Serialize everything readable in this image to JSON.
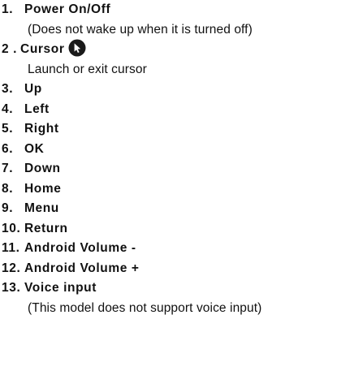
{
  "items": [
    {
      "num": "1.",
      "label": "Power On/Off",
      "note": "(Does not wake up when it is turned off)"
    },
    {
      "num": "2 .",
      "label": "Cursor",
      "icon": "cursor-arrow-icon",
      "note": "Launch or exit cursor"
    },
    {
      "num": "3.",
      "label": "Up"
    },
    {
      "num": "4.",
      "label": "Left"
    },
    {
      "num": "5.",
      "label": "Right"
    },
    {
      "num": "6.",
      "label": "OK"
    },
    {
      "num": "7.",
      "label": "Down"
    },
    {
      "num": "8.",
      "label": "Home"
    },
    {
      "num": "9.",
      "label": "Menu"
    },
    {
      "num": "10.",
      "label": "Return"
    },
    {
      "num": "11.",
      "label": "Android Volume -"
    },
    {
      "num": "12.",
      "label": "Android Volume +"
    },
    {
      "num": "13.",
      "label": "Voice input",
      "note": "(This model does not support voice input)"
    }
  ],
  "colors": {
    "text": "#111111",
    "icon_bg": "#1a1a1a",
    "icon_fg": "#ffffff"
  }
}
